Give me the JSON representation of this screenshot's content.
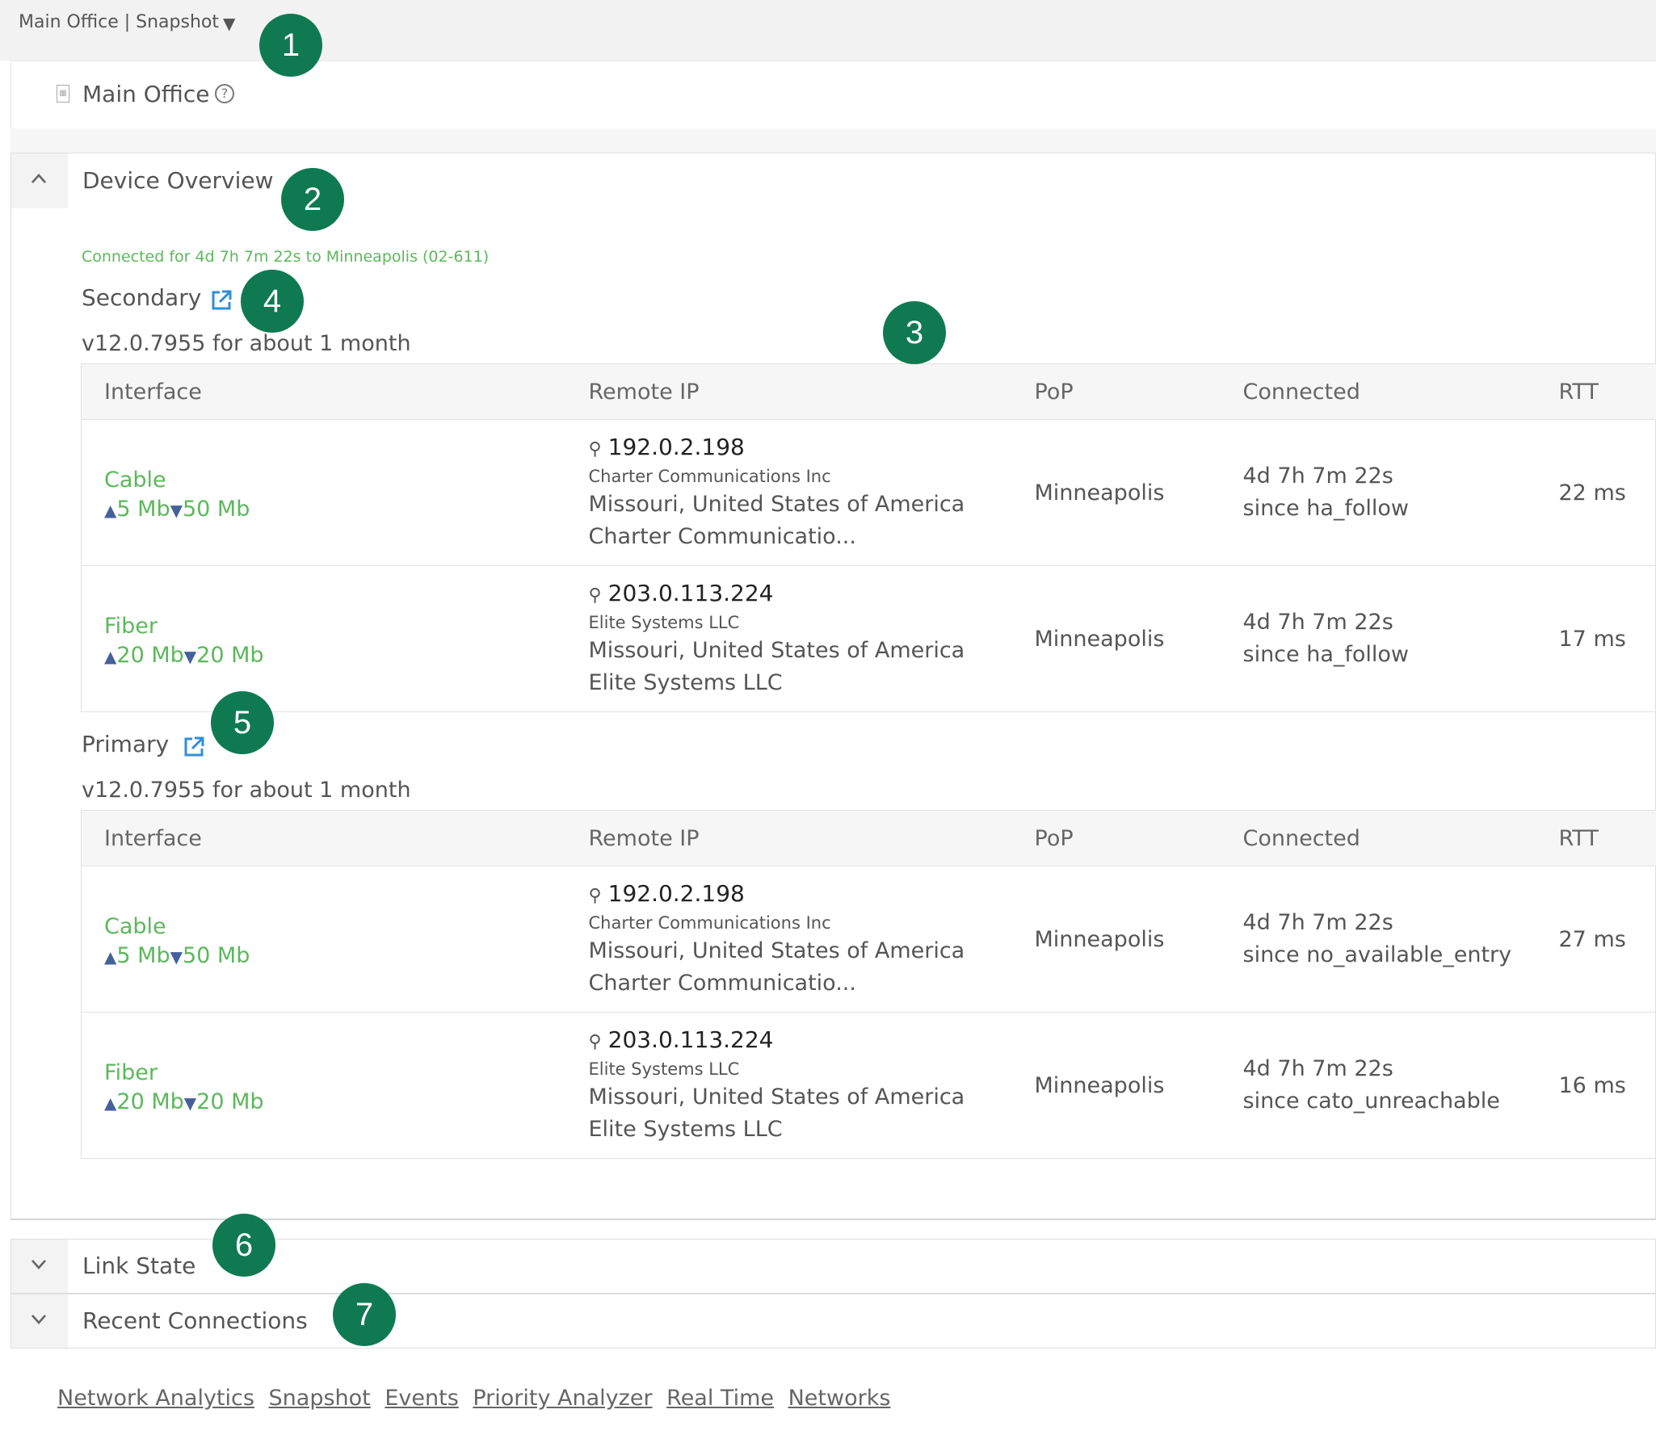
{
  "breadcrumb": {
    "text": "Main Office | Snapshot"
  },
  "site": {
    "name": "Main Office"
  },
  "overview": {
    "title": "Device Overview",
    "status": "Connected for 4d 7h 7m 22s to Minneapolis (02-611)"
  },
  "columns": [
    "Interface",
    "Remote IP",
    "PoP",
    "Connected",
    "RTT"
  ],
  "secondary": {
    "label": "Secondary",
    "version": "v12.0.7955 for about 1 month",
    "rows": [
      {
        "iface": "Cable",
        "up": "5 Mb",
        "down": "50 Mb",
        "ip": "192.0.2.198",
        "isp_small": "Charter Communications Inc",
        "location": "Missouri, United States of America",
        "isp": "Charter Communicatio...",
        "pop": "Minneapolis",
        "connected": "4d 7h 7m 22s",
        "since": "since ha_follow",
        "rtt": "22 ms"
      },
      {
        "iface": "Fiber",
        "up": "20 Mb",
        "down": "20 Mb",
        "ip": "203.0.113.224",
        "isp_small": "Elite Systems LLC",
        "location": "Missouri, United States of America",
        "isp": "Elite Systems LLC",
        "pop": "Minneapolis",
        "connected": "4d 7h 7m 22s",
        "since": "since ha_follow",
        "rtt": "17 ms"
      }
    ]
  },
  "primary": {
    "label": "Primary",
    "version": "v12.0.7955 for about 1 month",
    "rows": [
      {
        "iface": "Cable",
        "up": "5 Mb",
        "down": "50 Mb",
        "ip": "192.0.2.198",
        "isp_small": "Charter Communications Inc",
        "location": "Missouri, United States of America",
        "isp": "Charter Communicatio...",
        "pop": "Minneapolis",
        "connected": "4d 7h 7m 22s",
        "since": "since no_available_entry",
        "rtt": "27 ms"
      },
      {
        "iface": "Fiber",
        "up": "20 Mb",
        "down": "20 Mb",
        "ip": "203.0.113.224",
        "isp_small": "Elite Systems LLC",
        "location": "Missouri, United States of America",
        "isp": "Elite Systems LLC",
        "pop": "Minneapolis",
        "connected": "4d 7h 7m 22s",
        "since": "since cato_unreachable",
        "rtt": "16 ms"
      }
    ]
  },
  "sections": {
    "link_state": "Link State",
    "recent": "Recent Connections"
  },
  "footer_links": [
    "Network Analytics",
    "Snapshot",
    "Events",
    "Priority Analyzer",
    "Real Time",
    "Networks"
  ],
  "callouts": [
    "1",
    "2",
    "3",
    "4",
    "5",
    "6",
    "7"
  ],
  "colors": {
    "accent_green": "#5cb85c",
    "callout": "#0f7a52",
    "link_blue": "#2f8fd8",
    "arrow": "#44619b"
  }
}
